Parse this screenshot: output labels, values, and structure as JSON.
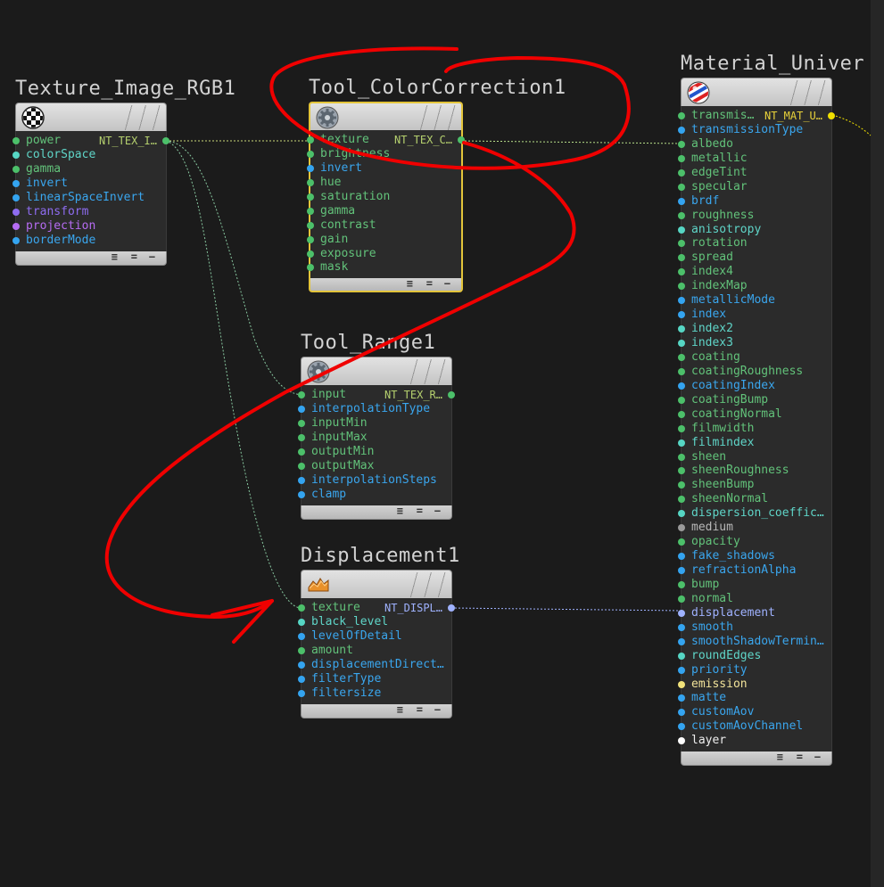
{
  "nodes": {
    "texture_image": {
      "title": "Texture_Image_RGB1",
      "icon": "checker-icon",
      "output_type": "NT_TEX_I…",
      "pins": [
        {
          "label": "power",
          "color": "green"
        },
        {
          "label": "colorSpace",
          "color": "teal"
        },
        {
          "label": "gamma",
          "color": "green"
        },
        {
          "label": "invert",
          "color": "blue"
        },
        {
          "label": "linearSpaceInvert",
          "color": "blue"
        },
        {
          "label": "transform",
          "color": "purple"
        },
        {
          "label": "projection",
          "color": "violet"
        },
        {
          "label": "borderMode",
          "color": "blue"
        }
      ]
    },
    "color_correction": {
      "title": "Tool_ColorCorrection1",
      "icon": "gear-icon",
      "output_type": "NT_TEX_C…",
      "pins": [
        {
          "label": "texture",
          "color": "green"
        },
        {
          "label": "brightness",
          "color": "green"
        },
        {
          "label": "invert",
          "color": "blue"
        },
        {
          "label": "hue",
          "color": "green"
        },
        {
          "label": "saturation",
          "color": "green"
        },
        {
          "label": "gamma",
          "color": "green"
        },
        {
          "label": "contrast",
          "color": "green"
        },
        {
          "label": "gain",
          "color": "green"
        },
        {
          "label": "exposure",
          "color": "green"
        },
        {
          "label": "mask",
          "color": "green"
        }
      ]
    },
    "tool_range": {
      "title": "Tool_Range1",
      "icon": "gear-icon",
      "output_type": "NT_TEX_R…",
      "pins": [
        {
          "label": "input",
          "color": "green"
        },
        {
          "label": "interpolationType",
          "color": "blue"
        },
        {
          "label": "inputMin",
          "color": "green"
        },
        {
          "label": "inputMax",
          "color": "green"
        },
        {
          "label": "outputMin",
          "color": "green"
        },
        {
          "label": "outputMax",
          "color": "green"
        },
        {
          "label": "interpolationSteps",
          "color": "blue"
        },
        {
          "label": "clamp",
          "color": "blue"
        }
      ]
    },
    "displacement": {
      "title": "Displacement1",
      "icon": "displacement-icon",
      "output_type": "NT_DISPL…",
      "pins": [
        {
          "label": "texture",
          "color": "green"
        },
        {
          "label": "black_level",
          "color": "teal"
        },
        {
          "label": "levelOfDetail",
          "color": "blue"
        },
        {
          "label": "amount",
          "color": "green"
        },
        {
          "label": "displacementDirect…",
          "color": "blue"
        },
        {
          "label": "filterType",
          "color": "blue"
        },
        {
          "label": "filtersize",
          "color": "blue"
        }
      ]
    },
    "material": {
      "title": "Material_Univer",
      "icon": "material-ball-icon",
      "output_type": "NT_MAT_U…",
      "pins": [
        {
          "label": "transmis…",
          "color": "green"
        },
        {
          "label": "transmissionType",
          "color": "blue"
        },
        {
          "label": "albedo",
          "color": "green"
        },
        {
          "label": "metallic",
          "color": "green"
        },
        {
          "label": "edgeTint",
          "color": "green"
        },
        {
          "label": "specular",
          "color": "green"
        },
        {
          "label": "brdf",
          "color": "blue"
        },
        {
          "label": "roughness",
          "color": "green"
        },
        {
          "label": "anisotropy",
          "color": "teal"
        },
        {
          "label": "rotation",
          "color": "green"
        },
        {
          "label": "spread",
          "color": "green"
        },
        {
          "label": "index4",
          "color": "green"
        },
        {
          "label": "indexMap",
          "color": "green"
        },
        {
          "label": "metallicMode",
          "color": "blue"
        },
        {
          "label": "index",
          "color": "blue"
        },
        {
          "label": "index2",
          "color": "teal"
        },
        {
          "label": "index3",
          "color": "teal"
        },
        {
          "label": "coating",
          "color": "green"
        },
        {
          "label": "coatingRoughness",
          "color": "green"
        },
        {
          "label": "coatingIndex",
          "color": "blue"
        },
        {
          "label": "coatingBump",
          "color": "green"
        },
        {
          "label": "coatingNormal",
          "color": "green"
        },
        {
          "label": "filmwidth",
          "color": "green"
        },
        {
          "label": "filmindex",
          "color": "teal"
        },
        {
          "label": "sheen",
          "color": "green"
        },
        {
          "label": "sheenRoughness",
          "color": "green"
        },
        {
          "label": "sheenBump",
          "color": "green"
        },
        {
          "label": "sheenNormal",
          "color": "green"
        },
        {
          "label": "dispersion_coeffic…",
          "color": "teal"
        },
        {
          "label": "medium",
          "color": "gray"
        },
        {
          "label": "opacity",
          "color": "green"
        },
        {
          "label": "fake_shadows",
          "color": "blue"
        },
        {
          "label": "refractionAlpha",
          "color": "blue"
        },
        {
          "label": "bump",
          "color": "green"
        },
        {
          "label": "normal",
          "color": "green"
        },
        {
          "label": "displacement",
          "color": "lav"
        },
        {
          "label": "smooth",
          "color": "blue"
        },
        {
          "label": "smoothShadowTermin…",
          "color": "blue"
        },
        {
          "label": "roundEdges",
          "color": "teal"
        },
        {
          "label": "priority",
          "color": "blue"
        },
        {
          "label": "emission",
          "color": "yellow"
        },
        {
          "label": "matte",
          "color": "blue"
        },
        {
          "label": "customAov",
          "color": "blue"
        },
        {
          "label": "customAovChannel",
          "color": "blue"
        },
        {
          "label": "layer",
          "color": "white"
        }
      ]
    }
  },
  "colors": {
    "background": "#1b1b1b",
    "selection": "#e3c43a",
    "annotation": "#ff0000",
    "wire": "#b8e08a"
  }
}
